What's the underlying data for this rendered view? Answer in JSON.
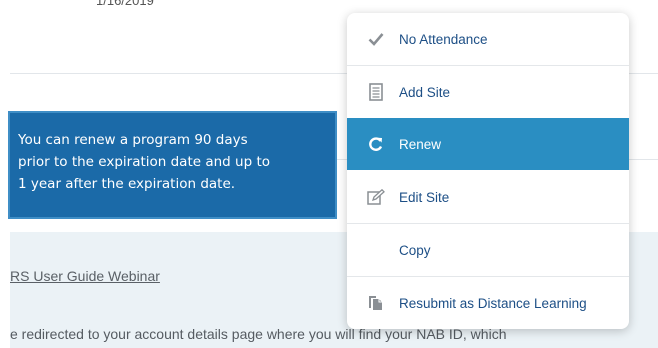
{
  "background": {
    "date_text": "1/16/2019"
  },
  "tooltip": {
    "lines": [
      "You can renew a program 90 days",
      "prior to the expiration date and up to",
      "1 year after the expiration date."
    ]
  },
  "info": {
    "guide_link": "RS User Guide Webinar",
    "body_text": "e redirected to your account details page where you will find your NAB ID, which"
  },
  "context_menu": {
    "items": [
      {
        "label": "No Attendance",
        "icon": "check-icon"
      },
      {
        "label": "Add Site",
        "icon": "document-icon"
      },
      {
        "label": "Renew",
        "icon": "refresh-icon",
        "active": true
      },
      {
        "label": "Edit Site",
        "icon": "edit-icon"
      },
      {
        "label": "Copy",
        "icon": ""
      },
      {
        "label": "Resubmit as Distance Learning",
        "icon": "copy-icon"
      }
    ]
  },
  "colors": {
    "tooltip_bg": "#1b6aa8",
    "active_item_bg": "#2a8ec2",
    "menu_text": "#1d4f86",
    "panel_bg": "#ebf2f6"
  }
}
